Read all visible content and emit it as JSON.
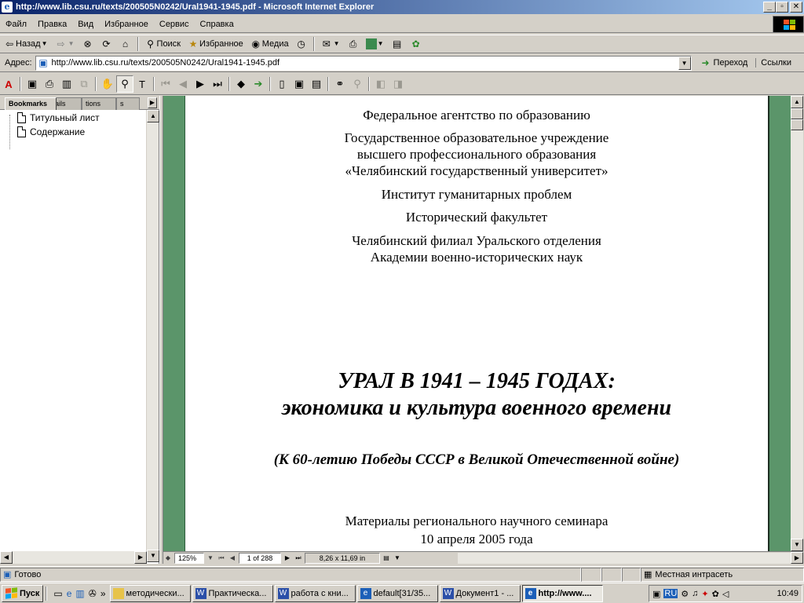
{
  "window": {
    "title": "http://www.lib.csu.ru/texts/200505N0242/Ural1941-1945.pdf - Microsoft Internet Explorer",
    "min_label": "_",
    "max_label": "▫",
    "close_label": "✕"
  },
  "menu": {
    "items": [
      "Файл",
      "Правка",
      "Вид",
      "Избранное",
      "Сервис",
      "Справка"
    ]
  },
  "toolbar": {
    "back_label": "Назад",
    "search_label": "Поиск",
    "favorites_label": "Избранное",
    "media_label": "Медиа"
  },
  "address": {
    "label": "Адрес:",
    "url": "http://www.lib.csu.ru/texts/200505N0242/Ural1941-1945.pdf",
    "go_label": "Переход",
    "links_label": "Ссылки"
  },
  "nav": {
    "tabs": [
      "Bookmarks",
      "nails",
      "tions",
      "s"
    ],
    "bookmarks": [
      "Титульный лист",
      "Содержание"
    ]
  },
  "document": {
    "lines": [
      "Федеральное агентство по образованию",
      "Государственное образовательное учреждение",
      "высшего профессионального образования",
      "«Челябинский государственный университет»",
      "Институт гуманитарных проблем",
      "Исторический факультет",
      "Челябинский филиал Уральского отделения",
      "Академии военно-исторических наук"
    ],
    "title_1": "УРАЛ В 1941 – 1945 ГОДАХ:",
    "title_2": "экономика и культура военного времени",
    "subtitle": "(К 60-летию Победы СССР в Великой Отечественной войне)",
    "footer_1": "Материалы регионального научного семинара",
    "footer_2": "10 апреля 2005 года"
  },
  "acrobat_status": {
    "zoom": "125%",
    "page": "1 of 288",
    "page_size": "8,26 x 11,69 in"
  },
  "ie_status": {
    "ready": "Готово",
    "zone": "Местная интрасеть"
  },
  "taskbar": {
    "start_label": "Пуск",
    "tasks": [
      "методически...",
      "Практическа...",
      "работа с кни...",
      "default[31/35...",
      "Документ1 - ...",
      "http://www...."
    ],
    "lang": "RU",
    "clock": "10:49"
  },
  "colors": {
    "title_gradient_start": "#0a246a",
    "title_gradient_end": "#a6caf0",
    "doc_background": "#5b956a",
    "chrome": "#d4d0c8"
  }
}
